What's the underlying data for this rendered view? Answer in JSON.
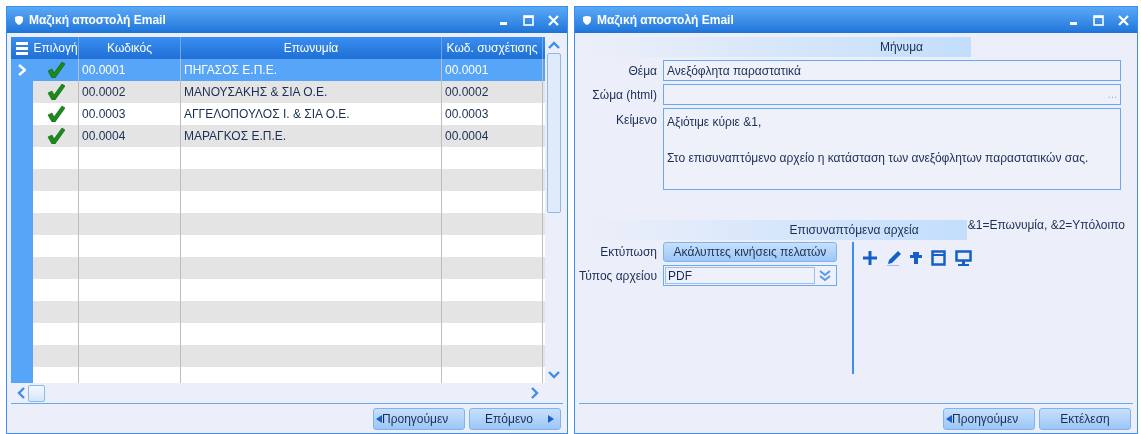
{
  "left_window": {
    "title": "Μαζική αποστολή Email",
    "grid": {
      "columns": [
        "Επιλογή",
        "Κωδικός",
        "Επωνυμία",
        "Κωδ. συσχέτισης"
      ],
      "rows": [
        {
          "code": "00.0001",
          "name": "ΠΗΓΑΣΟΣ Ε.Π.Ε.",
          "relation_code": "00.0001",
          "checked": true,
          "selected": true
        },
        {
          "code": "00.0002",
          "name": "ΜΑΝΟΥΣΑΚΗΣ & ΣΙΑ Ο.Ε.",
          "relation_code": "00.0002",
          "checked": true,
          "selected": false
        },
        {
          "code": "00.0003",
          "name": "ΑΓΓΕΛΟΠΟΥΛΟΣ Ι. & ΣΙΑ Ο.Ε.",
          "relation_code": "00.0003",
          "checked": true,
          "selected": false
        },
        {
          "code": "00.0004",
          "name": "ΜΑΡΑΓΚΟΣ Ε.Π.Ε.",
          "relation_code": "00.0004",
          "checked": true,
          "selected": false
        }
      ]
    },
    "buttons": [
      {
        "label": "Προηγούμεν",
        "kind": "prev"
      },
      {
        "label": "Επόμενο",
        "kind": "next"
      }
    ]
  },
  "right_window": {
    "title": "Μαζική αποστολή Email",
    "message_section": {
      "title": "Μήνυμα",
      "fields": [
        {
          "kind": "text",
          "label": "Θέμα",
          "value": "Ανεξόφλητα παραστατικά"
        },
        {
          "kind": "browse",
          "label": "Σώμα (html)",
          "button_text": "..."
        },
        {
          "kind": "memo",
          "label": "Κείμενο",
          "paragraphs": [
            "Αξιότιμε κύριε &1,",
            "Στο επισυναπτόμενο αρχείο η κατάσταση των ανεξόφλητων παραστατικών σας."
          ]
        }
      ]
    },
    "attachments": {
      "title": "Επισυναπτόμενα αρχεία",
      "legend": "&1=Επωνυμία, &2=Υπόλοιπο",
      "print_label": "Εκτύπωση",
      "print_button": "Ακάλυπτες κινήσεις πελατών",
      "file_type_label": "Τύπος αρχείου",
      "file_type_value": "PDF"
    },
    "buttons": [
      {
        "label": "Προηγούμεν",
        "kind": "prev"
      },
      {
        "label": "Εκτέλεση",
        "kind": "plain"
      }
    ]
  }
}
